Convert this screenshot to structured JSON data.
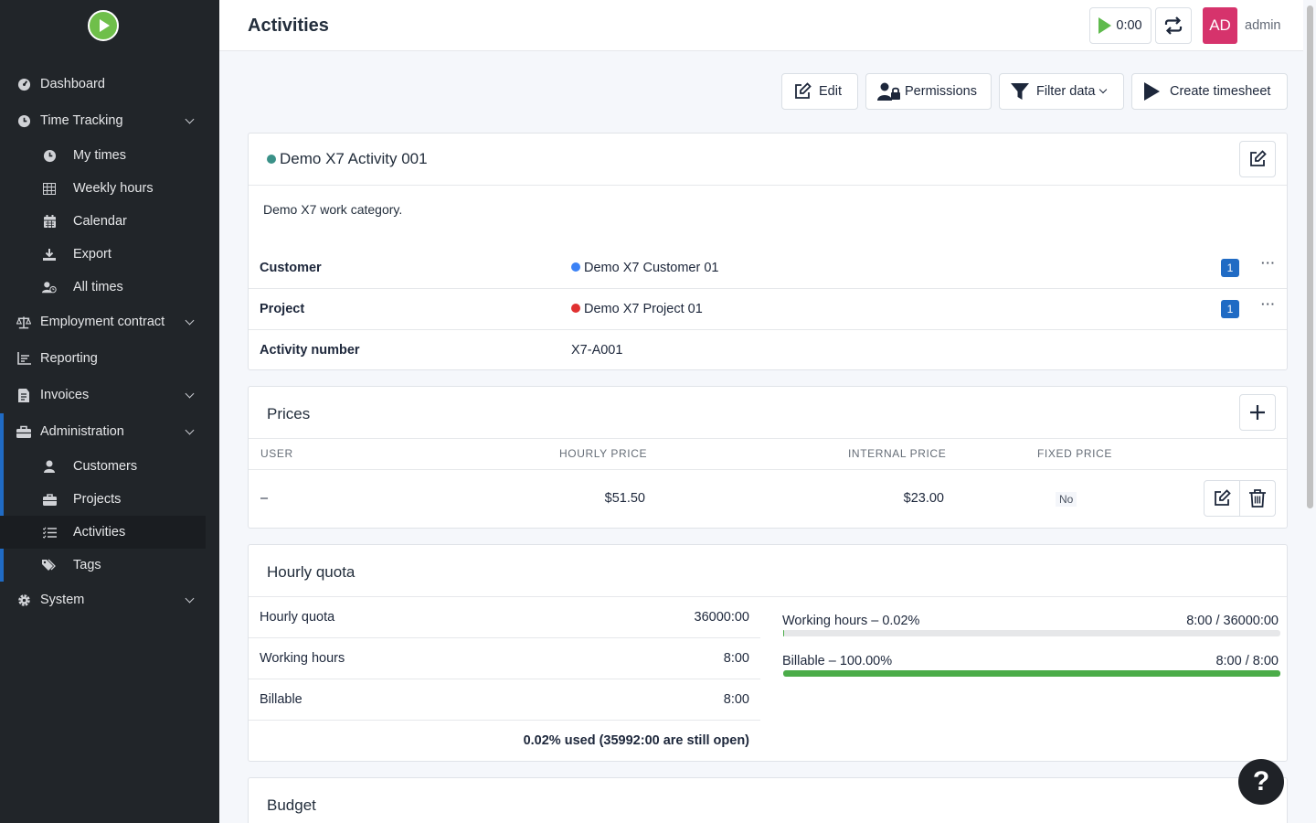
{
  "header": {
    "title": "Activities",
    "timer": "0:00",
    "avatar_initials": "AD",
    "user_name": "admin"
  },
  "sidebar": {
    "items": [
      {
        "label": "Dashboard",
        "icon": "dashboard-icon"
      },
      {
        "label": "Time Tracking",
        "icon": "clock-icon"
      },
      {
        "label": "My times",
        "icon": "clock-icon"
      },
      {
        "label": "Weekly hours",
        "icon": "grid-icon"
      },
      {
        "label": "Calendar",
        "icon": "calendar-icon"
      },
      {
        "label": "Export",
        "icon": "download-icon"
      },
      {
        "label": "All times",
        "icon": "user-clock-icon"
      },
      {
        "label": "Employment contract",
        "icon": "scale-icon"
      },
      {
        "label": "Reporting",
        "icon": "chart-icon"
      },
      {
        "label": "Invoices",
        "icon": "invoice-icon"
      },
      {
        "label": "Administration",
        "icon": "toolbox-icon"
      },
      {
        "label": "Customers",
        "icon": "user-icon"
      },
      {
        "label": "Projects",
        "icon": "briefcase-icon"
      },
      {
        "label": "Activities",
        "icon": "list-icon"
      },
      {
        "label": "Tags",
        "icon": "tags-icon"
      },
      {
        "label": "System",
        "icon": "gear-icon"
      }
    ]
  },
  "toolbar": {
    "edit": "Edit",
    "permissions": "Permissions",
    "filter": "Filter data",
    "create_timesheet": "Create timesheet"
  },
  "activity": {
    "name": "Demo X7 Activity 001",
    "color": "#3a9188",
    "description": "Demo X7 work category.",
    "rows": [
      {
        "label": "Customer",
        "value": "Demo X7 Customer 01",
        "color": "#3b82f6",
        "badge": "1"
      },
      {
        "label": "Project",
        "value": "Demo X7 Project 01",
        "color": "#e03131",
        "badge": "1"
      },
      {
        "label": "Activity number",
        "value": "X7-A001"
      }
    ]
  },
  "prices": {
    "title": "Prices",
    "columns": [
      "USER",
      "HOURLY PRICE",
      "INTERNAL PRICE",
      "FIXED PRICE"
    ],
    "rows": [
      {
        "user": "–",
        "hourly": "$51.50",
        "internal": "$23.00",
        "fixed": "No"
      }
    ]
  },
  "quota": {
    "title": "Hourly quota",
    "rows": [
      {
        "label": "Hourly quota",
        "value": "36000:00"
      },
      {
        "label": "Working hours",
        "value": "8:00"
      },
      {
        "label": "Billable",
        "value": "8:00"
      }
    ],
    "summary": "0.02% used (35992:00 are still open)",
    "bars": [
      {
        "label": "Working hours – 0.02%",
        "value": "8:00 / 36000:00",
        "percent": 0.02
      },
      {
        "label": "Billable – 100.00%",
        "value": "8:00 / 8:00",
        "percent": 100
      }
    ]
  },
  "budget": {
    "title": "Budget"
  },
  "help": "?"
}
